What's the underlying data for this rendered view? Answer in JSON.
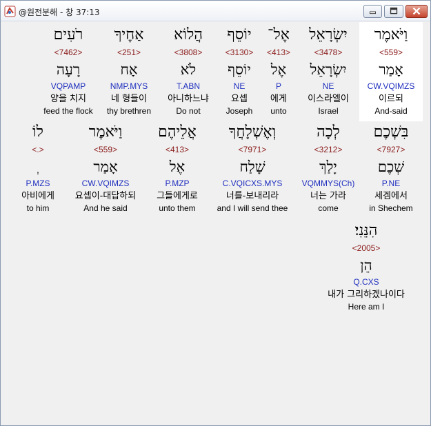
{
  "window": {
    "title": "@원전분해 - 창 37:13",
    "app_icon": "app-logo-icon",
    "buttons": [
      "minimize-icon",
      "maximize-icon",
      "close-icon"
    ]
  },
  "words": [
    {
      "hebrew": "וַיֹּאמֶר",
      "strong": "<559>",
      "root": "אָמַר",
      "parse": "CW.VQIMZS",
      "korean": "이르되",
      "english": "And-said",
      "selected": true
    },
    {
      "hebrew": "יִשְׂרָאֵל",
      "strong": "<3478>",
      "root": "יִשְׂרָאֵל",
      "parse": "NE",
      "korean": "이스라엘이",
      "english": "Israel"
    },
    {
      "hebrew": "אֶל־",
      "strong": "<413>",
      "root": "אֶל",
      "parse": "P",
      "korean": "에게",
      "english": "unto"
    },
    {
      "hebrew": "יוֹסֵף",
      "strong": "<3130>",
      "root": "יוֹסֵף",
      "parse": "NE",
      "korean": "요셉",
      "english": "Joseph"
    },
    {
      "hebrew": "הֲלוֹא",
      "strong": "<3808>",
      "root": "לֹא",
      "parse": "T.ABN",
      "korean": "아니하느냐",
      "english": "Do not"
    },
    {
      "hebrew": "אַחֶיךָ",
      "strong": "<251>",
      "root": "אָח",
      "parse": "NMP.MYS",
      "korean": "네 형들이",
      "english": "thy brethren"
    },
    {
      "hebrew": "רֹעִים",
      "strong": "<7462>",
      "root": "רָעָה",
      "parse": "VQPAMP",
      "korean": "양을 치지",
      "english": "feed the flock"
    },
    {
      "hebrew": "בִּשְׁכֶם",
      "strong": "<7927>",
      "root": "שְׁכֶם",
      "parse": "P.NE",
      "korean": "세겜에서",
      "english": "in Shechem"
    },
    {
      "hebrew": "לְכָה",
      "strong": "<3212>",
      "root": "יָלַךְ",
      "parse": "VQMMYS(Ch)",
      "korean": "너는 가라",
      "english": "come"
    },
    {
      "hebrew": "וְאֶשְׁלָחֲךָ",
      "strong": "<7971>",
      "root": "שָׁלַח",
      "parse": "C.VQICXS.MYS",
      "korean": "너를-보내리라",
      "english": "and I will send thee"
    },
    {
      "hebrew": "אֲלֵיהֶם",
      "strong": "<413>",
      "root": "אֶל",
      "parse": "P.MZP",
      "korean": "그들에게로",
      "english": "unto them"
    },
    {
      "hebrew": "וַיֹּאמֶר",
      "strong": "<559>",
      "root": "אָמַר",
      "parse": "CW.VQIMZS",
      "korean": "요셉이-대답하되",
      "english": "And he said"
    },
    {
      "hebrew": "לוֹ",
      "strong": "<.>",
      "root": "ְ",
      "parse": "P.MZS",
      "korean": "아비에게",
      "english": "to him"
    },
    {
      "hebrew": "הִנֵּנִי׃",
      "strong": "<2005>",
      "root": "הֵן",
      "parse": "Q.CXS",
      "korean": "내가 그리하겠나이다",
      "english": "Here am I"
    }
  ]
}
